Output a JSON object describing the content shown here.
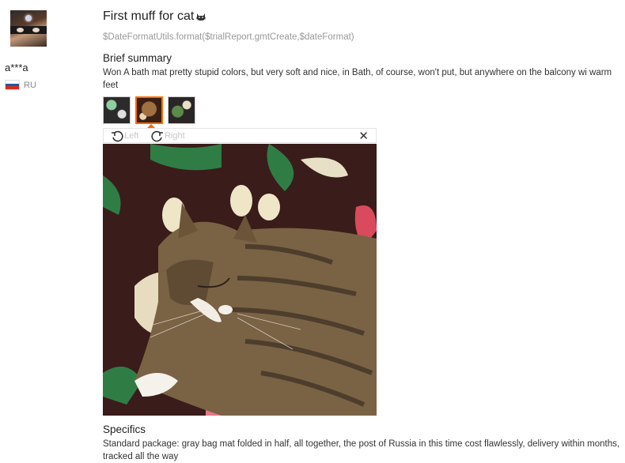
{
  "reviewer": {
    "avatar_alt": "avatar",
    "name": "a***a",
    "country": "RU",
    "flag_colors": [
      "#ffffff",
      "#1c57a5",
      "#d52b1e"
    ]
  },
  "review": {
    "title": "First muff for cat",
    "date_template": "$DateFormatUtils.format($trialReport.gmtCreate,$dateFormat)",
    "brief_heading": "Brief summary",
    "brief_text": "Won A bath mat pretty stupid colors, but very soft and nice, in Bath, of course, won't put, but anywhere on the balcony wi warm feet",
    "specifics_heading": "Specifics",
    "specifics_text": "Standard package: gray bag mat folded in half, all together, the post of Russia in this time cost flawlessly, delivery within months, tracked all the way"
  },
  "gallery": {
    "thumbnails": [
      "photo-1",
      "photo-2",
      "photo-3"
    ],
    "active_index": 1,
    "rotate_left_label": "Left",
    "rotate_right_label": "Right",
    "close_symbol": "✕",
    "accent_color": "#ff6a00"
  }
}
